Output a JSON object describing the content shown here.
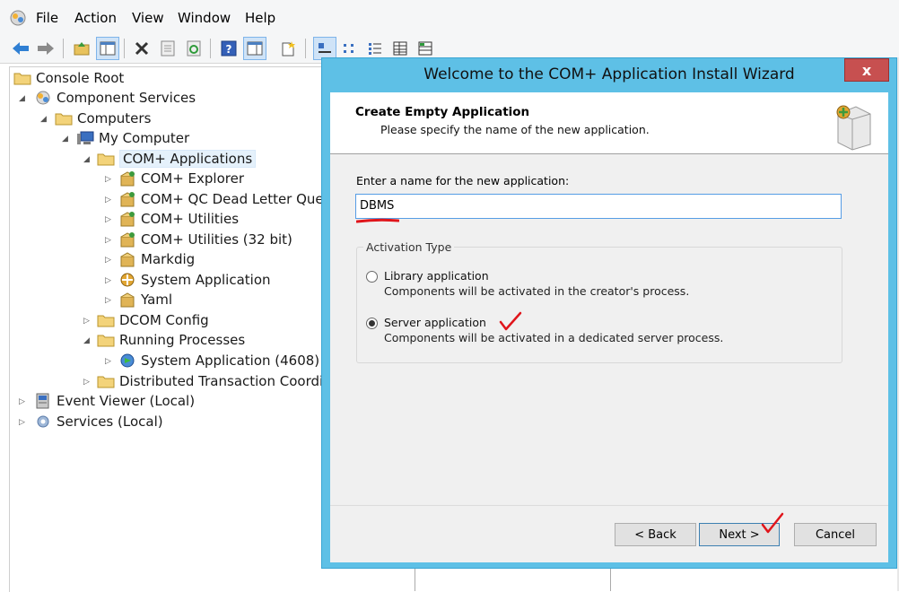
{
  "menubar": {
    "items": [
      "File",
      "Action",
      "View",
      "Window",
      "Help"
    ]
  },
  "toolbar": {
    "icons": [
      "back-icon",
      "forward-icon",
      "up-folder-icon",
      "show-hide-tree-icon",
      "delete-icon",
      "properties-icon",
      "refresh-icon",
      "help-icon",
      "show-hide-action-pane-icon",
      "new-icon",
      "large-icons-view-icon",
      "small-icons-view-icon",
      "list-view-icon",
      "detail-view-icon",
      "status-view-icon"
    ]
  },
  "tree": {
    "items": [
      {
        "label": "Console Root",
        "icon": "folder-icon"
      },
      {
        "label": "Component Services",
        "icon": "component-services-icon"
      },
      {
        "label": "Computers",
        "icon": "folder-icon"
      },
      {
        "label": "My Computer",
        "icon": "computer-icon"
      },
      {
        "label": "COM+ Applications",
        "icon": "folder-icon"
      },
      {
        "label": "COM+ Explorer",
        "icon": "package-icon"
      },
      {
        "label": "COM+ QC Dead Letter Queue",
        "icon": "package-icon"
      },
      {
        "label": "COM+ Utilities",
        "icon": "package-icon"
      },
      {
        "label": "COM+ Utilities (32 bit)",
        "icon": "package-icon"
      },
      {
        "label": "Markdig",
        "icon": "package-icon"
      },
      {
        "label": "System Application",
        "icon": "package-icon"
      },
      {
        "label": "Yaml",
        "icon": "package-icon"
      },
      {
        "label": "DCOM Config",
        "icon": "folder-icon"
      },
      {
        "label": "Running Processes",
        "icon": "folder-icon"
      },
      {
        "label": "System Application (4608)",
        "icon": "process-icon"
      },
      {
        "label": "Distributed Transaction Coordinat",
        "icon": "folder-icon"
      },
      {
        "label": "Event Viewer (Local)",
        "icon": "event-viewer-icon"
      },
      {
        "label": "Services (Local)",
        "icon": "services-icon"
      }
    ]
  },
  "dialog": {
    "title": "Welcome to the COM+ Application Install Wizard",
    "close": "x",
    "header_title": "Create Empty Application",
    "header_subtitle": "Please specify the name of the new application.",
    "name_label": "Enter a name for the new application:",
    "name_value": "DBMS",
    "group_label": "Activation Type",
    "option1_label": "Library application",
    "option1_desc": "Components will be activated in the creator's process.",
    "option2_label": "Server application",
    "option2_desc": "Components will be activated in a dedicated server process.",
    "selected_option": "Server application",
    "back": "< Back",
    "next": "Next >",
    "cancel": "Cancel"
  },
  "colors": {
    "dialog_frame": "#5ec0e6",
    "close_button": "#c75050",
    "annotation": "#e0151b"
  }
}
